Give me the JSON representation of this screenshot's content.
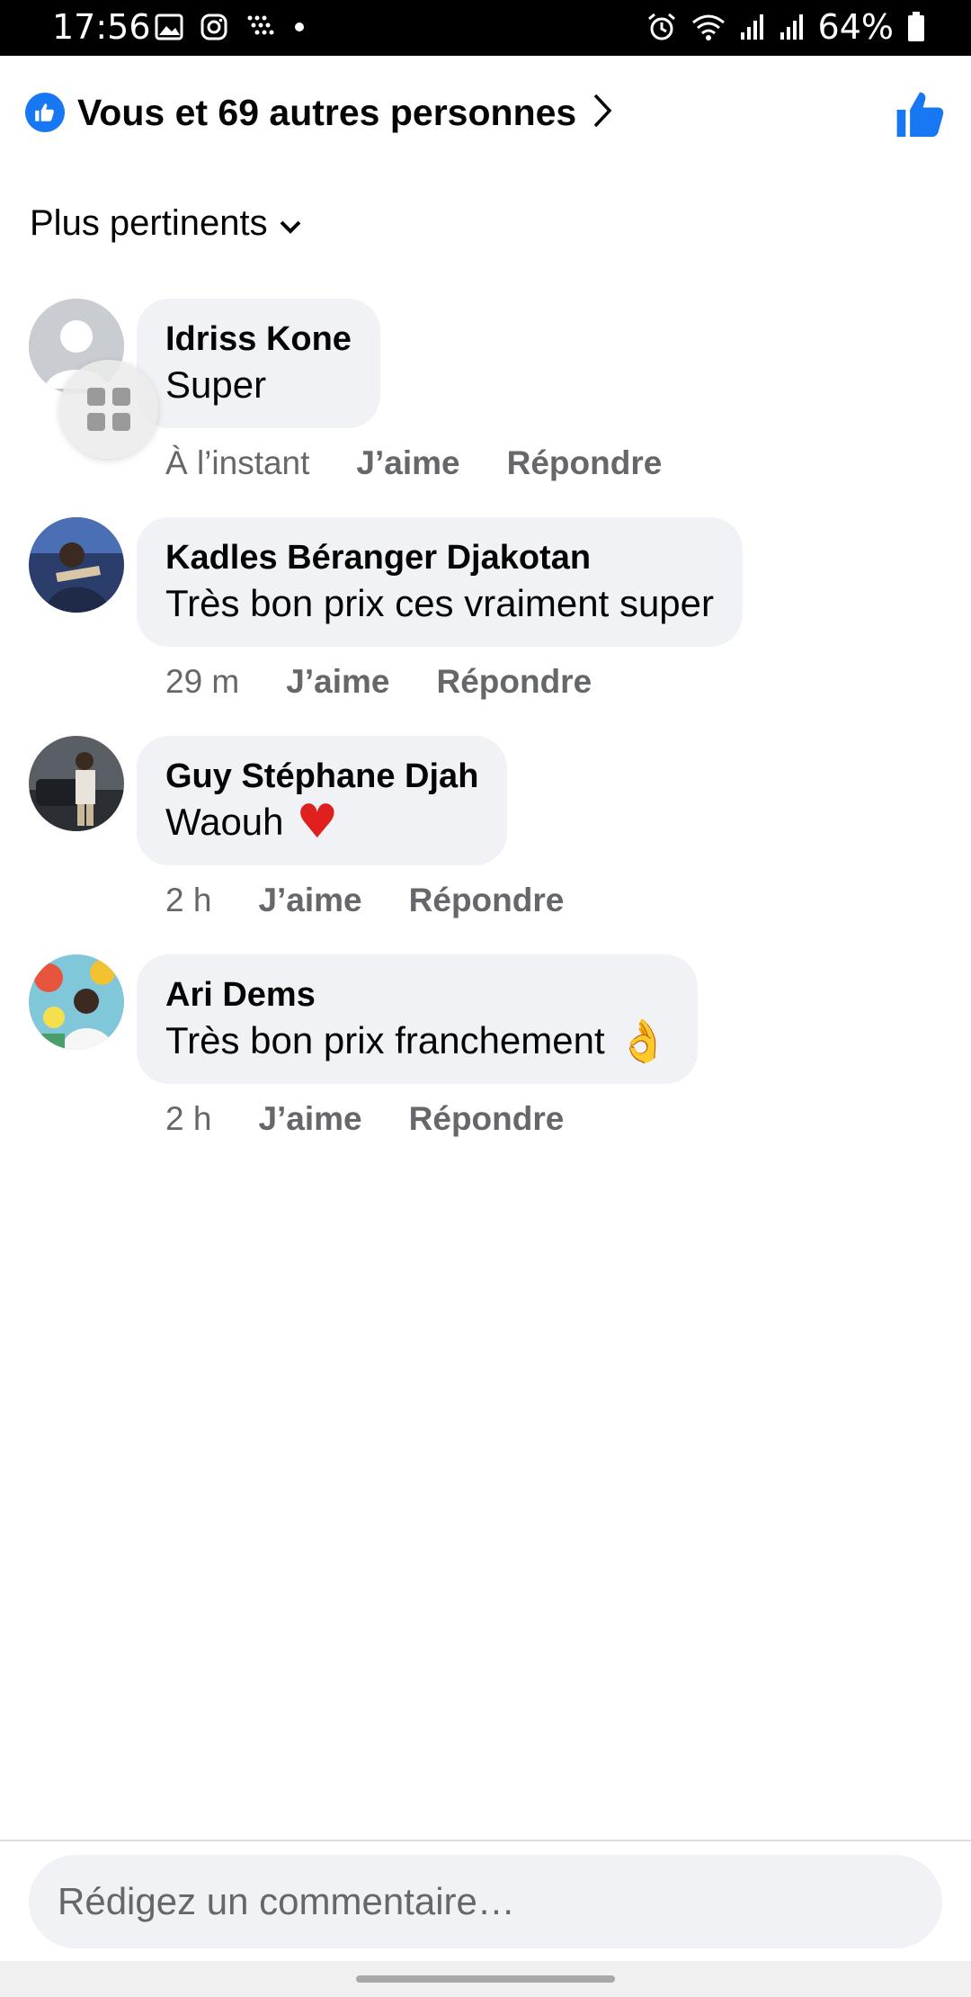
{
  "status_bar": {
    "time": "17:56",
    "battery": "64%",
    "icons": [
      "gallery-icon",
      "instagram-icon",
      "app-grid-icon",
      "dot-icon",
      "alarm-icon",
      "wifi-icon",
      "signal-icon",
      "signal-icon",
      "battery-icon"
    ]
  },
  "reactions": {
    "summary": "Vous et 69 autres personnes",
    "accent": "#1877f2"
  },
  "sort": {
    "label": "Plus pertinents"
  },
  "comments": [
    {
      "author": "Idriss Kone",
      "text": "Super",
      "emoji": "",
      "time": "À l’instant",
      "like": "J’aime",
      "reply": "Répondre"
    },
    {
      "author": "Kadles Béranger Djakotan",
      "text": "Très bon prix ces vraiment super",
      "emoji": "",
      "time": "29 m",
      "like": "J’aime",
      "reply": "Répondre"
    },
    {
      "author": "Guy Stéphane Djah",
      "text": "Waouh",
      "emoji": "♥",
      "time": "2 h",
      "like": "J’aime",
      "reply": "Répondre"
    },
    {
      "author": "Ari Dems",
      "text": "Très bon prix franchement",
      "emoji": "👌",
      "time": "2 h",
      "like": "J’aime",
      "reply": "Répondre"
    }
  ],
  "composer": {
    "placeholder": "Rédigez un commentaire…"
  }
}
